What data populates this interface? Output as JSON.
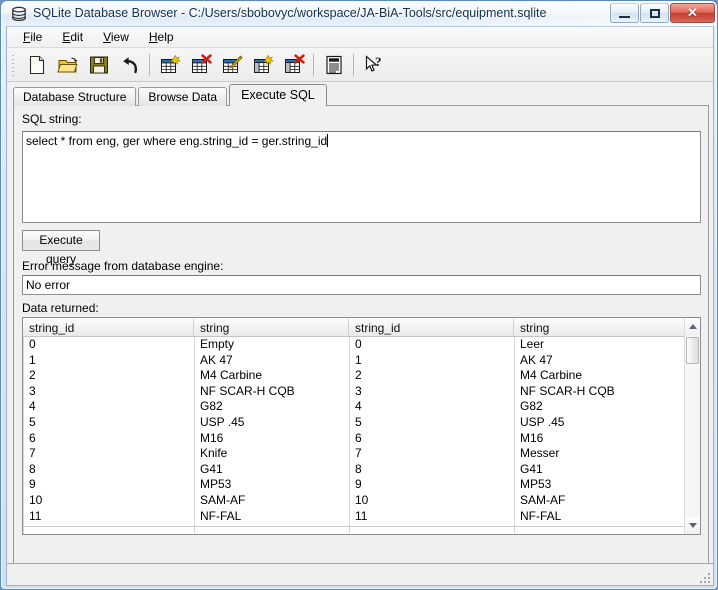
{
  "window": {
    "title": "SQLite Database Browser - C:/Users/sbobovyc/workspace/JA-BiA-Tools/src/equipment.sqlite",
    "app_icon": "database-icon",
    "buttons": {
      "minimize": "minimize-icon",
      "maximize": "maximize-icon",
      "close": "✕"
    }
  },
  "menubar": {
    "items": [
      {
        "label": "File",
        "mnemonic": "F",
        "rest": "ile"
      },
      {
        "label": "Edit",
        "mnemonic": "E",
        "rest": "dit"
      },
      {
        "label": "View",
        "mnemonic": "V",
        "rest": "iew"
      },
      {
        "label": "Help",
        "mnemonic": "H",
        "rest": "elp"
      }
    ]
  },
  "toolbar": {
    "buttons": [
      {
        "name": "new-database-icon",
        "tip": "New Database"
      },
      {
        "name": "open-database-icon",
        "tip": "Open Database"
      },
      {
        "name": "save-icon",
        "tip": "Save"
      },
      {
        "name": "revert-icon",
        "tip": "Revert Changes"
      },
      {
        "name": "create-table-icon",
        "tip": "Create Table"
      },
      {
        "name": "delete-table-icon",
        "tip": "Delete Table"
      },
      {
        "name": "modify-table-icon",
        "tip": "Modify Table"
      },
      {
        "name": "create-field-icon",
        "tip": "Create Field"
      },
      {
        "name": "delete-field-icon",
        "tip": "Delete Field"
      },
      {
        "name": "log-icon",
        "tip": "Log"
      },
      {
        "name": "help-cursor-icon",
        "tip": "What's This?"
      }
    ]
  },
  "tabs": [
    {
      "label": "Database Structure",
      "active": false
    },
    {
      "label": "Browse Data",
      "active": false
    },
    {
      "label": "Execute SQL",
      "active": true
    }
  ],
  "panel": {
    "sql_label": "SQL string:",
    "sql_value": "select * from eng, ger where eng.string_id = ger.string_id",
    "execute_button": "Execute query",
    "error_label": "Error message from database engine:",
    "error_value": "No error",
    "data_label": "Data returned:"
  },
  "grid": {
    "columns": [
      "string_id",
      "string",
      "string_id",
      "string"
    ],
    "rows": [
      [
        "0",
        "Empty",
        "0",
        "Leer"
      ],
      [
        "1",
        "AK 47",
        "1",
        "AK 47"
      ],
      [
        "2",
        "M4 Carbine",
        "2",
        "M4 Carbine"
      ],
      [
        "3",
        "NF SCAR-H CQB",
        "3",
        "NF SCAR-H CQB"
      ],
      [
        "4",
        "G82",
        "4",
        "G82"
      ],
      [
        "5",
        "USP .45",
        "5",
        "USP .45"
      ],
      [
        "6",
        "M16",
        "6",
        "M16"
      ],
      [
        "7",
        "Knife",
        "7",
        "Messer"
      ],
      [
        "8",
        "G41",
        "8",
        "G41"
      ],
      [
        "9",
        "MP53",
        "9",
        "MP53"
      ],
      [
        "10",
        "SAM-AF",
        "10",
        "SAM-AF"
      ],
      [
        "11",
        "NF-FAL",
        "11",
        "NF-FAL"
      ]
    ],
    "scrollbar": {
      "up": "scroll-up-arrow",
      "down": "scroll-down-arrow"
    }
  },
  "colors": {
    "accent": "#5d89b5",
    "close_red": "#c43f32",
    "title_text": "#15314f",
    "panel_bg": "#f0f0f0"
  }
}
